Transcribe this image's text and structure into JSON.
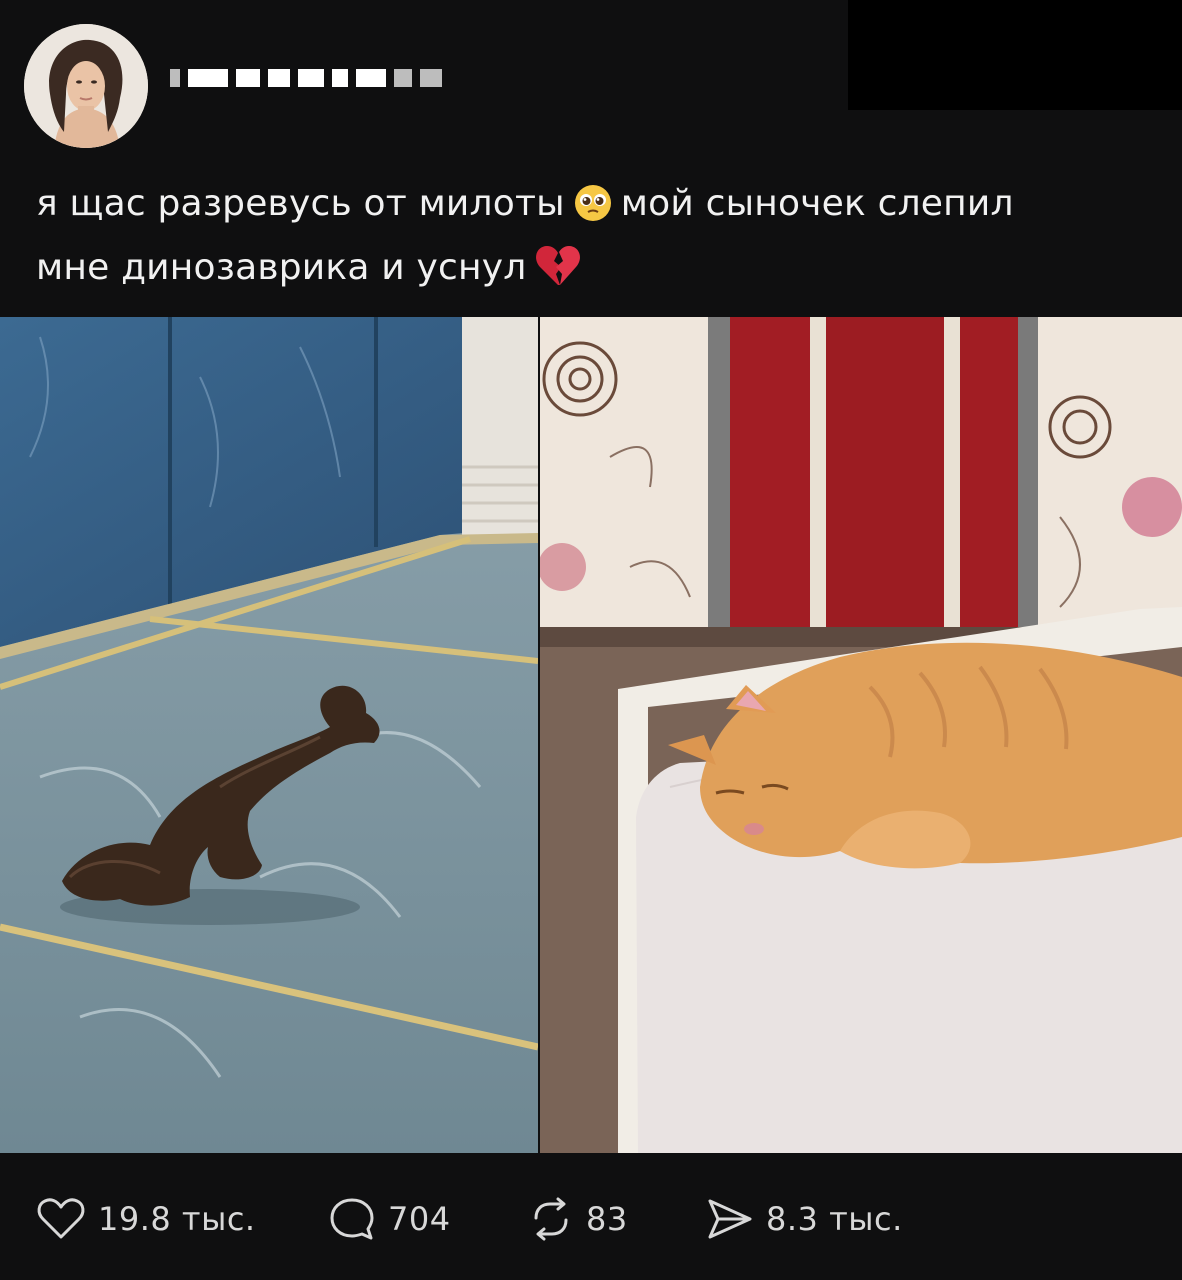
{
  "post": {
    "author": {
      "avatar_alt_icon": "profile-avatar"
    },
    "text": {
      "line1_part1": "я щас разревусь от милоты",
      "line1_emoji": "🥹",
      "line1_part2": "мой сыночек слепил",
      "line2_part1": "мне динозаврика и уснул",
      "line2_emoji": "💔"
    },
    "images": [
      {
        "icon": "photo-clay-dinosaur"
      },
      {
        "icon": "photo-sleeping-ginger-cat"
      }
    ]
  },
  "actions": {
    "likes": {
      "icon": "heart-icon",
      "count": "19.8 тыс."
    },
    "comments": {
      "icon": "comment-icon",
      "count": "704"
    },
    "reposts": {
      "icon": "repost-icon",
      "count": "83"
    },
    "shares": {
      "icon": "send-icon",
      "count": "8.3 тыс."
    }
  },
  "colors": {
    "background": "#0f0f10",
    "text": "#f1f1f1",
    "muted": "#d8d8d8"
  }
}
